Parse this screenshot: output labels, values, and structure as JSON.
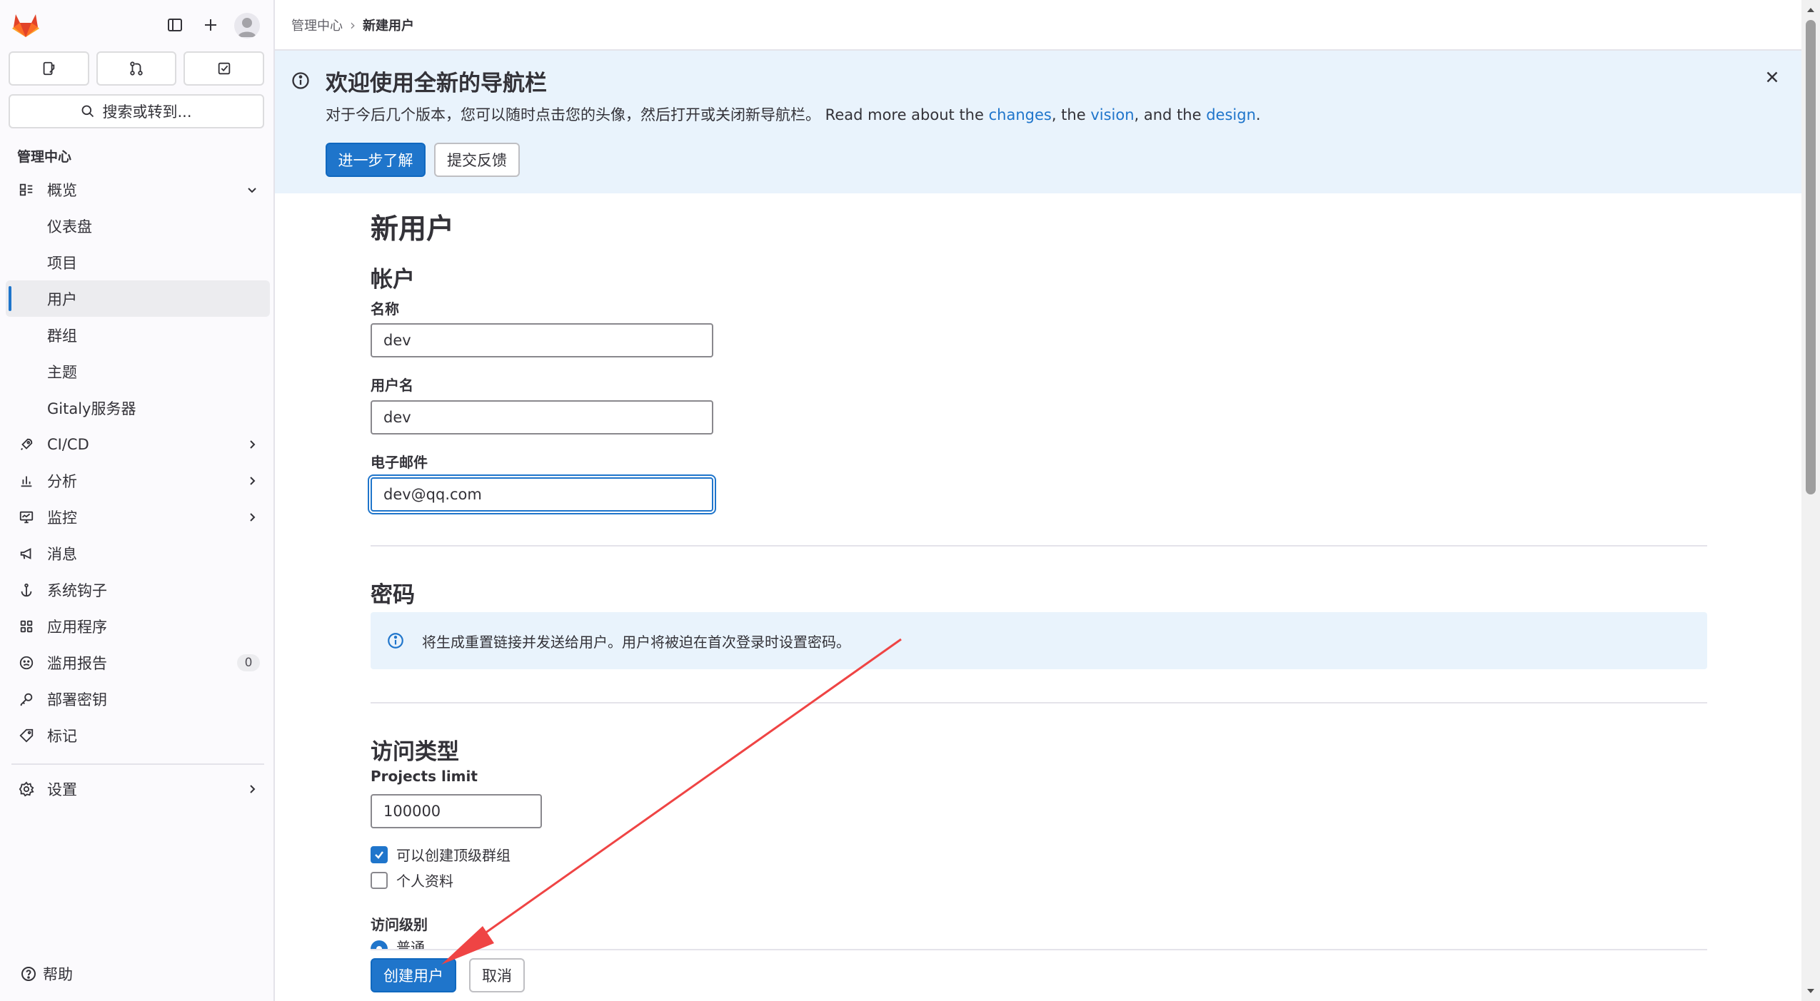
{
  "colors": {
    "accent": "#1f75cb",
    "banner_bg": "#e9f3fc",
    "annotation_arrow": "#ef4444",
    "logo_orange": "#e24329"
  },
  "sidebar": {
    "top_icons": [
      "sidebar-toggle-icon",
      "plus-icon",
      "avatar"
    ],
    "action_buttons": [
      "issues-icon",
      "merge-request-icon",
      "todo-icon"
    ],
    "search_label": "搜索或转到...",
    "section_title": "管理中心",
    "items": [
      {
        "label": "概览",
        "icon": "overview-icon",
        "expanded": true
      },
      {
        "label": "仪表盘"
      },
      {
        "label": "项目"
      },
      {
        "label": "用户",
        "active": true
      },
      {
        "label": "群组"
      },
      {
        "label": "主题"
      },
      {
        "label": "Gitaly服务器"
      },
      {
        "label": "CI/CD",
        "icon": "rocket-icon"
      },
      {
        "label": "分析",
        "icon": "analytics-icon"
      },
      {
        "label": "监控",
        "icon": "monitor-icon"
      },
      {
        "label": "消息",
        "icon": "megaphone-icon"
      },
      {
        "label": "系统钩子",
        "icon": "anchor-icon"
      },
      {
        "label": "应用程序",
        "icon": "applications-icon"
      },
      {
        "label": "滥用报告",
        "icon": "abuse-icon",
        "badge": "0"
      },
      {
        "label": "部署密钥",
        "icon": "key-icon"
      },
      {
        "label": "标记",
        "icon": "label-icon"
      },
      {
        "label": "设置",
        "icon": "settings-icon"
      }
    ],
    "help_label": "帮助"
  },
  "breadcrumb": {
    "parent": "管理中心",
    "separator": "›",
    "current": "新建用户"
  },
  "banner": {
    "title": "欢迎使用全新的导航栏",
    "text_prefix": "对于今后几个版本，您可以随时点击您的头像，然后打开或关闭新导航栏。 Read more about the ",
    "link_changes": "changes",
    "text_mid1": ", the ",
    "link_vision": "vision",
    "text_mid2": ", and the ",
    "link_design": "design",
    "text_suffix": ".",
    "learn_more_label": "进一步了解",
    "feedback_label": "提交反馈"
  },
  "form": {
    "page_title": "新用户",
    "account_heading": "帐户",
    "name_label": "名称",
    "name_value": "dev",
    "username_label": "用户名",
    "username_value": "dev",
    "email_label": "电子邮件",
    "email_value": "dev@qq.com",
    "password_heading": "密码",
    "password_info": "将生成重置链接并发送给用户。用户将被迫在首次登录时设置密码。",
    "access_heading": "访问类型",
    "projects_limit_label": "Projects limit",
    "projects_limit_value": "100000",
    "can_create_group_label": "可以创建顶级群组",
    "can_create_group_checked": true,
    "private_profile_label": "个人资料",
    "private_profile_checked": false,
    "access_level_label": "访问级别",
    "access_level_option": "普通",
    "create_button": "创建用户",
    "cancel_button": "取消"
  }
}
